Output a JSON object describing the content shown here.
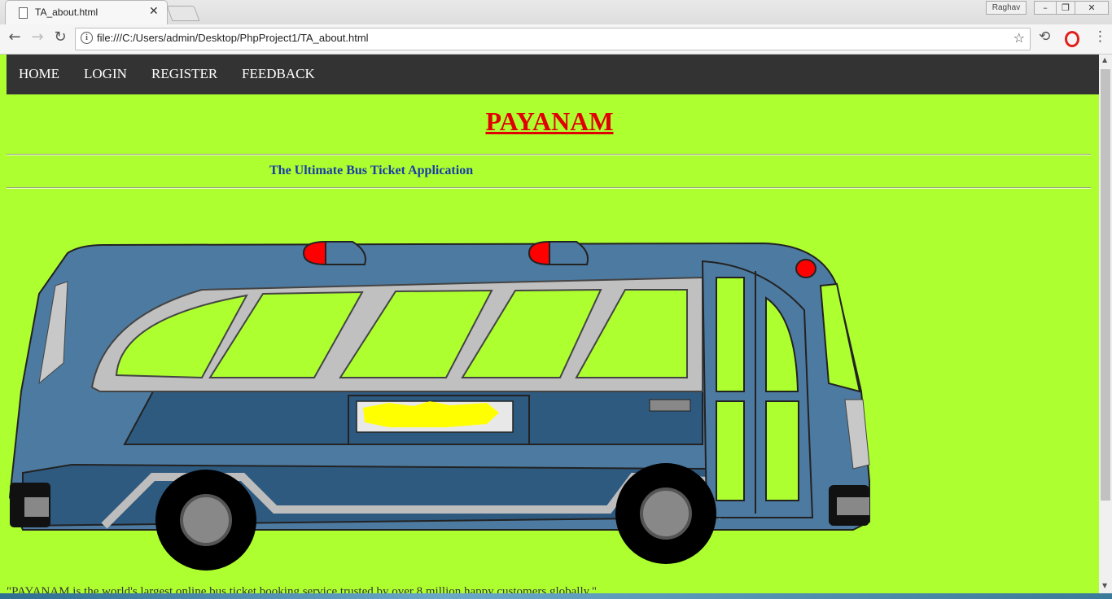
{
  "browser": {
    "tab_title": "TA_about.html",
    "tab_close": "✕",
    "profile_name": "Raghav",
    "url": "file:///C:/Users/admin/Desktop/PhpProject1/TA_about.html",
    "info_glyph": "i",
    "star_glyph": "☆",
    "history_glyph": "⟲",
    "menu_glyph": "⋮",
    "back_glyph": "←",
    "forward_glyph": "→",
    "reload_glyph": "↻",
    "minimize_glyph": "–",
    "restore_glyph": "❐",
    "close_glyph": "✕"
  },
  "nav": {
    "items": [
      {
        "label": "HOME"
      },
      {
        "label": "LOGIN"
      },
      {
        "label": "REGISTER"
      },
      {
        "label": "FEEDBACK"
      }
    ]
  },
  "header": {
    "brand": "PAYANAM",
    "tagline": "The Ultimate Bus Ticket Application"
  },
  "body_text": {
    "cut_off_line": "\"PAYANAM is the world's largest online bus ticket booking service trusted by over 8 million happy customers globally.\""
  },
  "colors": {
    "page_background": "#adff2f",
    "menubar": "#333333",
    "brand": "#e00000",
    "tagline": "#1a3da6"
  }
}
